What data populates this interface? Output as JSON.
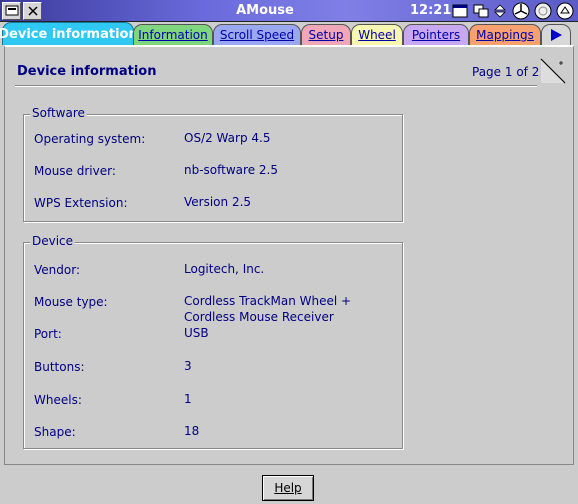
{
  "window": {
    "title": "AMouse",
    "clock": "12:21"
  },
  "tabs": [
    {
      "label": "Device information",
      "active": true,
      "color": "#2ec8f2"
    },
    {
      "label": "Information",
      "color": "#7fd67f"
    },
    {
      "label": "Scroll Speed",
      "color": "#9aa8f0"
    },
    {
      "label": "Setup",
      "color": "#f0a8b8"
    },
    {
      "label": "Wheel",
      "color": "#f7f7b0"
    },
    {
      "label": "Pointers",
      "color": "#c8a8f0"
    },
    {
      "label": "Mappings",
      "color": "#f7a070"
    }
  ],
  "page": {
    "title": "Device information",
    "page_indicator": "Page 1 of 2"
  },
  "software": {
    "label": "Software",
    "rows": [
      {
        "label": "Operating system:",
        "value": "OS/2 Warp 4.5"
      },
      {
        "label": "Mouse driver:",
        "value": "nb-software 2.5"
      },
      {
        "label": "WPS Extension:",
        "value": "Version 2.5"
      }
    ]
  },
  "device": {
    "label": "Device",
    "rows": [
      {
        "label": "Vendor:",
        "value": "Logitech, Inc."
      },
      {
        "label": "Mouse type:",
        "value": "Cordless TrackMan Wheel +",
        "value2": "Cordless Mouse Receiver"
      },
      {
        "label": "Port:",
        "value": "USB"
      },
      {
        "label": "Buttons:",
        "value": "3"
      },
      {
        "label": "Wheels:",
        "value": "1"
      },
      {
        "label": "Shape:",
        "value": "18"
      }
    ]
  },
  "buttons": {
    "help": "Help"
  }
}
